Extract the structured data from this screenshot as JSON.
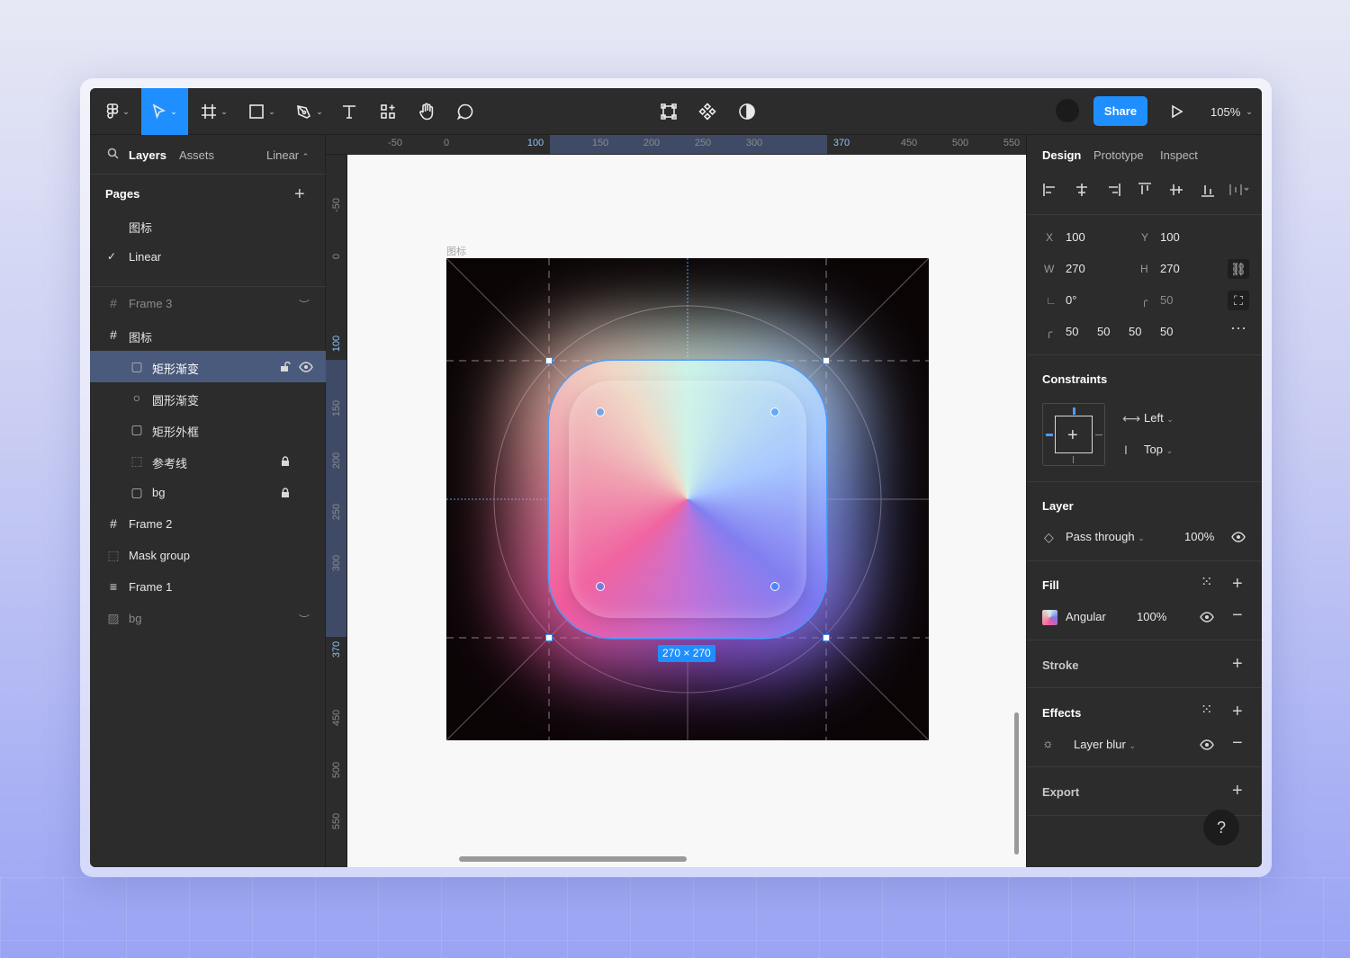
{
  "toolbar": {
    "zoom": "105%",
    "share_label": "Share",
    "tools": [
      "figma-menu",
      "move",
      "frame",
      "rectangle",
      "pen",
      "text",
      "components",
      "hand",
      "comment"
    ]
  },
  "left_panel": {
    "tabs": {
      "layers": "Layers",
      "assets": "Assets",
      "page_select": "Linear"
    },
    "pages_title": "Pages",
    "pages": [
      {
        "label": "图标",
        "current": false
      },
      {
        "label": "Linear",
        "current": true
      }
    ],
    "layers": [
      {
        "label": "Frame 3",
        "icon": "frame-icon",
        "hidden": true
      },
      {
        "label": "图标",
        "icon": "frame-icon"
      },
      {
        "label": "矩形渐变",
        "icon": "rectangle-icon",
        "selected": true
      },
      {
        "label": "圆形渐变",
        "icon": "ellipse-icon"
      },
      {
        "label": "矩形外框",
        "icon": "rectangle-icon"
      },
      {
        "label": "参考线",
        "icon": "dotted-rect-icon",
        "locked": true
      },
      {
        "label": "bg",
        "icon": "rectangle-icon",
        "locked": true
      },
      {
        "label": "Frame 2",
        "icon": "frame-icon"
      },
      {
        "label": "Mask group",
        "icon": "mask-icon"
      },
      {
        "label": "Frame 1",
        "icon": "auto-layout-icon"
      },
      {
        "label": "bg",
        "icon": "image-icon",
        "hidden": true
      }
    ]
  },
  "rulers": {
    "top": [
      "-50",
      "0",
      "100",
      "150",
      "200",
      "250",
      "300",
      "370",
      "450",
      "500",
      "550"
    ],
    "left": [
      "-50",
      "0",
      "100",
      "150",
      "200",
      "250",
      "300",
      "370",
      "450",
      "500",
      "550"
    ]
  },
  "canvas": {
    "frame_label": "图标",
    "size_badge": "270 × 270"
  },
  "right_panel": {
    "tabs": {
      "design": "Design",
      "prototype": "Prototype",
      "inspect": "Inspect"
    },
    "props": {
      "x_key": "X",
      "x": "100",
      "y_key": "Y",
      "y": "100",
      "w_key": "W",
      "w": "270",
      "h_key": "H",
      "h": "270",
      "rotation": "0°",
      "radius": "50",
      "corners": [
        "50",
        "50",
        "50",
        "50"
      ]
    },
    "constraints": {
      "title": "Constraints",
      "horizontal": "Left",
      "vertical": "Top"
    },
    "layer": {
      "title": "Layer",
      "blend": "Pass through",
      "opacity": "100%"
    },
    "fill": {
      "title": "Fill",
      "type": "Angular",
      "opacity": "100%"
    },
    "stroke": {
      "title": "Stroke"
    },
    "effects": {
      "title": "Effects",
      "item": "Layer blur"
    },
    "export": {
      "title": "Export"
    },
    "help": "?"
  }
}
